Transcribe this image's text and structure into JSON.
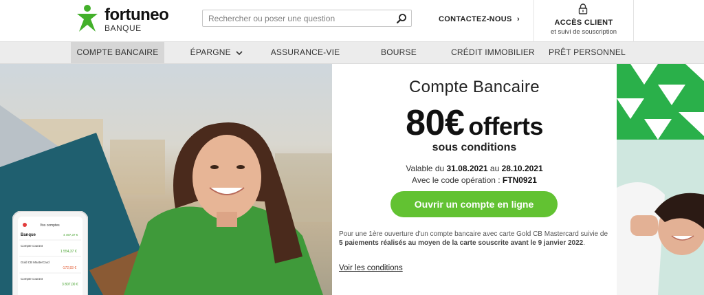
{
  "header": {
    "brand": "fortuneo",
    "brand_sub": "BANQUE",
    "search_placeholder": "Rechercher ou poser une question",
    "contact_label": "CONTACTEZ-NOUS",
    "access_title": "ACCÈS CLIENT",
    "access_sub": "et suivi de souscription"
  },
  "nav": {
    "items": [
      {
        "label": "COMPTE BANCAIRE"
      },
      {
        "label": "ÉPARGNE"
      },
      {
        "label": "ASSURANCE-VIE"
      },
      {
        "label": "BOURSE"
      },
      {
        "label": "CRÉDIT IMMOBILIER"
      },
      {
        "label": "PRÊT PERSONNEL"
      }
    ]
  },
  "promo": {
    "kicker": "Compte Bancaire",
    "amount": "80€",
    "offer": "offerts",
    "conditions": "sous conditions",
    "valid_prefix": "Valable du ",
    "valid_from": "31.08.2021",
    "valid_mid": " au ",
    "valid_to": "28.10.2021",
    "code_prefix": "Avec le code opération : ",
    "code": "FTN0921",
    "cta_label": "Ouvrir un compte en ligne",
    "fine_part1": "Pour une 1ère ouverture d'un compte bancaire avec carte Gold CB Mastercard suivie de ",
    "fine_bold": "5 paiements réalisés au moyen de la carte souscrite avant le 9 janvier 2022",
    "fine_end": ".",
    "terms_label": "Voir les conditions"
  },
  "phone": {
    "title": "Vos comptes",
    "section": "Banque",
    "rows": [
      {
        "label": "Compte courant",
        "value": "1 554,37 €"
      },
      {
        "label": "Gold CB MasterCard",
        "value": "-172,83 €"
      },
      {
        "label": "Compte courant",
        "value": "3 807,00 €"
      }
    ],
    "header_value": "4 497,37 €"
  },
  "colors": {
    "brand_green": "#62c232",
    "nav_bg": "#ececec"
  }
}
